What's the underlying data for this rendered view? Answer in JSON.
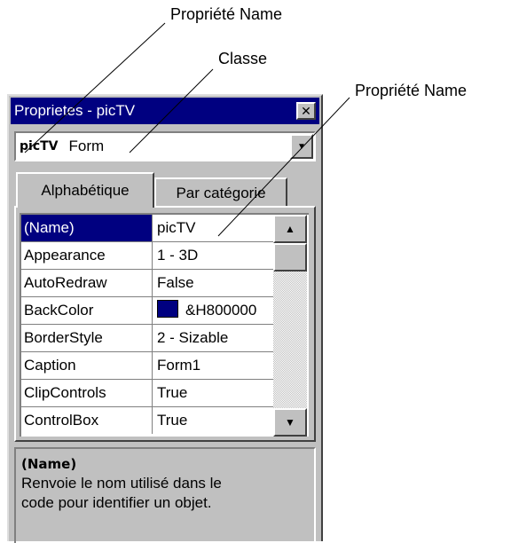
{
  "annotations": {
    "name_top": "Propriété Name",
    "class": "Classe",
    "name_right": "Propriété Name"
  },
  "window": {
    "title": "Proprietes - picTV",
    "close_glyph": "✕"
  },
  "object_selector": {
    "name": "picTV",
    "class": "Form",
    "dropdown_glyph": "▼"
  },
  "tabs": {
    "alphabetique": "Alphabétique",
    "par_categorie": "Par catégorie"
  },
  "properties": [
    {
      "name": "(Name)",
      "value": "picTV",
      "selected": true
    },
    {
      "name": "Appearance",
      "value": "1 - 3D"
    },
    {
      "name": "AutoRedraw",
      "value": "False"
    },
    {
      "name": "BackColor",
      "value": "&H800000",
      "swatch": "#000080"
    },
    {
      "name": "BorderStyle",
      "value": "2 - Sizable"
    },
    {
      "name": "Caption",
      "value": "Form1"
    },
    {
      "name": "ClipControls",
      "value": "True"
    },
    {
      "name": "ControlBox",
      "value": "True"
    }
  ],
  "scrollbar": {
    "up_glyph": "▲",
    "down_glyph": "▼"
  },
  "description": {
    "title": "(Name)",
    "line1": "Renvoie le nom utilisé dans le",
    "line2": "code pour identifier un objet."
  },
  "colors": {
    "titlebar": "#000080",
    "selection": "#000080",
    "face": "#c0c0c0"
  }
}
